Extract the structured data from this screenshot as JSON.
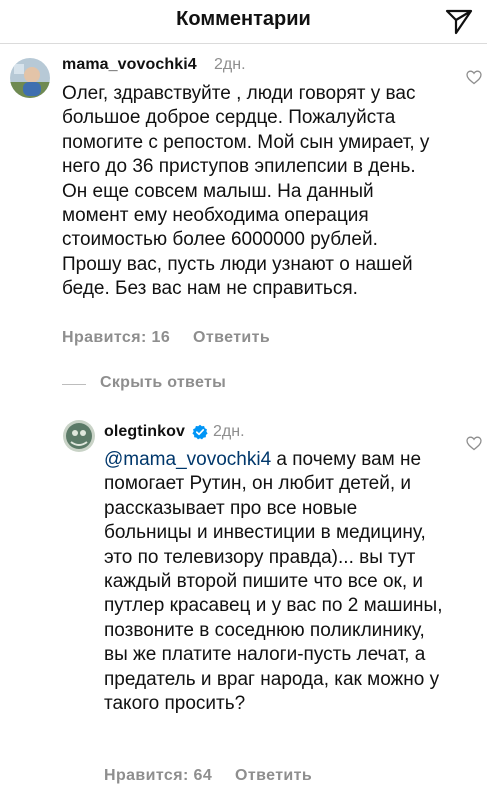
{
  "header": {
    "title": "Комментарии"
  },
  "comments": [
    {
      "username": "mama_vovochki4",
      "time": "2дн.",
      "text": "Олег, здравствуйте , люди говорят у вас большое доброе сердце. Пожалуйста помогите с репостом. Мой сын умирает,  у него до 36 приступов эпилепсии в день. Он еще совсем малыш. На данный момент ему необходима операция стоимостью более 6000000 рублей. Прошу вас, пусть люди узнают о нашей беде. Без вас нам не справиться.",
      "likes_label": "Нравится: 16",
      "reply_label": "Ответить"
    }
  ],
  "replies_toggle": "Скрыть ответы",
  "reply": {
    "username": "olegtinkov",
    "time": "2дн.",
    "mention": "@mama_vovochki4",
    "text": " а почему вам не помогает Рутин, он любит детей, и рассказывает про все новые больницы и инвестиции в медицину, это по телевизору правда)... вы тут каждый второй пишите что все ок, и путлер красавец и у вас по 2 машины, позвоните в соседнюю поликлинику, вы же платите налоги-пусть лечат, а предатель и враг народа, как можно у такого просить?",
    "likes_label": "Нравится: 64",
    "reply_label": "Ответить"
  },
  "icons": {
    "send": "send-icon",
    "heart": "heart-outline-icon",
    "verified": "verified-badge-icon"
  },
  "colors": {
    "mention": "#00376b",
    "verified": "#0095f6",
    "muted": "#8e8e8e"
  }
}
